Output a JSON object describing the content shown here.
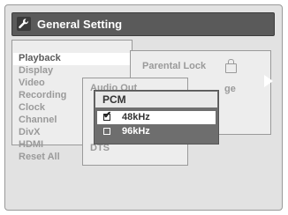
{
  "header": {
    "title": "General Setting",
    "icon": "wrench-icon"
  },
  "main_menu": {
    "items": [
      {
        "label": "Playback",
        "active": true
      },
      {
        "label": "Display"
      },
      {
        "label": "Video"
      },
      {
        "label": "Recording"
      },
      {
        "label": "Clock"
      },
      {
        "label": "Channel"
      },
      {
        "label": "DivX"
      },
      {
        "label": "HDMI"
      },
      {
        "label": "Reset All"
      }
    ]
  },
  "playback_submenu": {
    "items": [
      {
        "label": "Parental Lock",
        "icon": "lock-icon"
      },
      {
        "label": "ge"
      }
    ]
  },
  "audio_menu": {
    "items": [
      {
        "label": "Audio Out"
      },
      {
        "label": "DTS"
      }
    ]
  },
  "pcm_dialog": {
    "title": "PCM",
    "options": [
      {
        "label": "48kHz",
        "checked": true,
        "selected": true
      },
      {
        "label": "96kHz",
        "checked": false,
        "selected": false
      }
    ]
  }
}
